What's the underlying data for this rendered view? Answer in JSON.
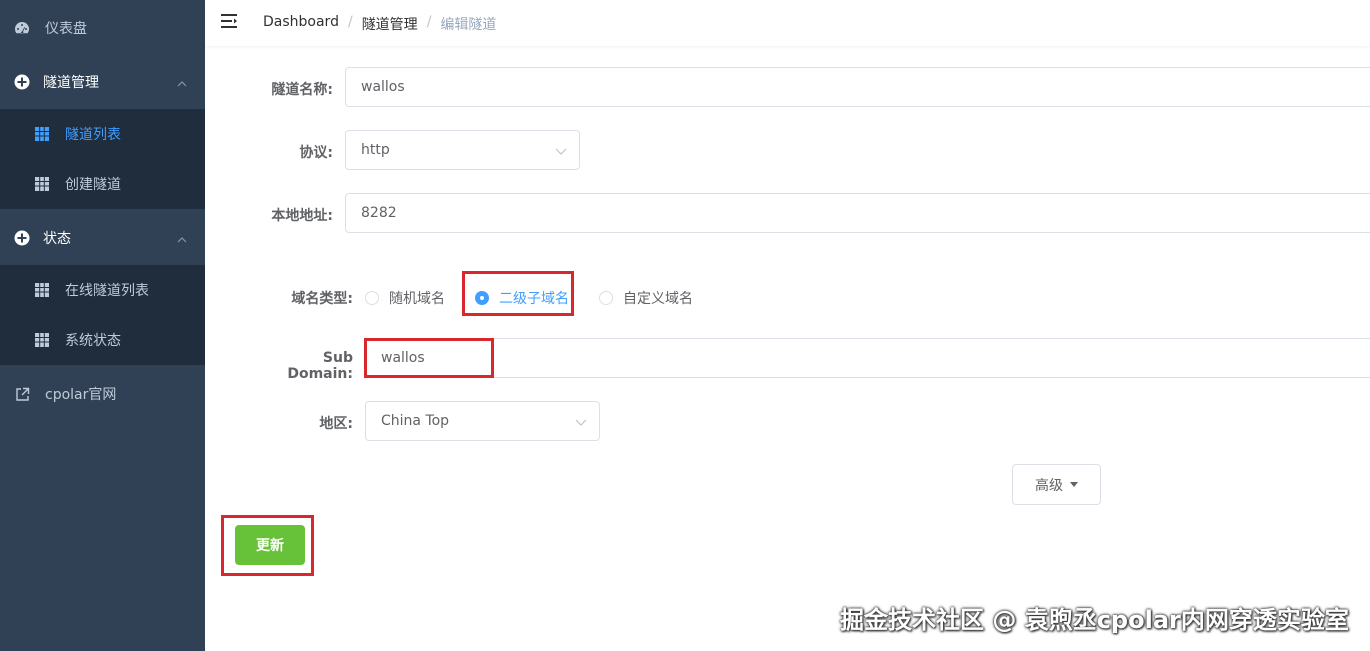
{
  "sidebar": {
    "items": [
      {
        "label": "仪表盘",
        "icon": "dashboard-icon"
      },
      {
        "label": "隧道管理",
        "icon": "plus-circle-icon",
        "children": [
          {
            "label": "隧道列表",
            "active": true
          },
          {
            "label": "创建隧道"
          }
        ]
      },
      {
        "label": "状态",
        "icon": "plus-circle-icon",
        "children": [
          {
            "label": "在线隧道列表"
          },
          {
            "label": "系统状态"
          }
        ]
      },
      {
        "label": "cpolar官网",
        "icon": "external-link-icon"
      }
    ]
  },
  "breadcrumb": [
    "Dashboard",
    "隧道管理",
    "编辑隧道"
  ],
  "form": {
    "name_label": "隧道名称:",
    "name_value": "wallos",
    "protocol_label": "协议:",
    "protocol_value": "http",
    "local_label": "本地地址:",
    "local_value": "8282",
    "domain_type_label": "域名类型:",
    "domain_options": [
      "随机域名",
      "二级子域名",
      "自定义域名"
    ],
    "domain_selected": "二级子域名",
    "subdomain_label": "Sub Domain:",
    "subdomain_value": "wallos",
    "region_label": "地区:",
    "region_value": "China Top",
    "advanced_label": "高级",
    "update_label": "更新"
  },
  "watermark": "掘金技术社区 @ 袁煦丞cpolar内网穿透实验室",
  "colors": {
    "sidebar_bg": "#304156",
    "submenu_bg": "#1f2d3d",
    "active": "#409eff",
    "success": "#67c23a",
    "highlight": "#d9272e"
  }
}
